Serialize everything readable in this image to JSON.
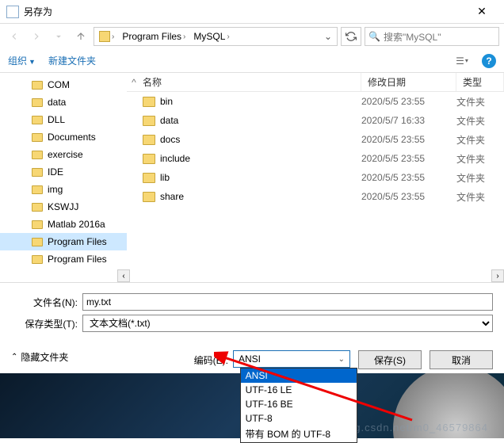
{
  "title": "另存为",
  "path": {
    "segments": [
      "Program Files",
      "MySQL"
    ]
  },
  "search": {
    "placeholder": "搜索\"MySQL\""
  },
  "toolbar": {
    "organize": "组织",
    "new_folder": "新建文件夹"
  },
  "sidebar": {
    "items": [
      {
        "label": "COM"
      },
      {
        "label": "data"
      },
      {
        "label": "DLL"
      },
      {
        "label": "Documents"
      },
      {
        "label": "exercise"
      },
      {
        "label": "IDE"
      },
      {
        "label": "img"
      },
      {
        "label": "KSWJJ"
      },
      {
        "label": "Matlab 2016a"
      },
      {
        "label": "Program Files",
        "selected": true
      },
      {
        "label": "Program Files"
      }
    ]
  },
  "columns": {
    "name": "名称",
    "date": "修改日期",
    "type": "类型"
  },
  "files": [
    {
      "name": "bin",
      "date": "2020/5/5 23:55",
      "type": "文件夹"
    },
    {
      "name": "data",
      "date": "2020/5/7 16:33",
      "type": "文件夹"
    },
    {
      "name": "docs",
      "date": "2020/5/5 23:55",
      "type": "文件夹"
    },
    {
      "name": "include",
      "date": "2020/5/5 23:55",
      "type": "文件夹"
    },
    {
      "name": "lib",
      "date": "2020/5/5 23:55",
      "type": "文件夹"
    },
    {
      "name": "share",
      "date": "2020/5/5 23:55",
      "type": "文件夹"
    }
  ],
  "form": {
    "filename_label": "文件名(N):",
    "filename_value": "my.txt",
    "filetype_label": "保存类型(T):",
    "filetype_value": "文本文档(*.txt)"
  },
  "bottom": {
    "hide_folders": "隐藏文件夹",
    "encoding_label": "编码(E):",
    "encoding_value": "ANSI",
    "encoding_options": [
      {
        "label": "ANSI",
        "selected": true
      },
      {
        "label": "UTF-16 LE"
      },
      {
        "label": "UTF-16 BE"
      },
      {
        "label": "UTF-8"
      },
      {
        "label": "带有 BOM 的 UTF-8"
      }
    ],
    "save": "保存(S)",
    "cancel": "取消"
  },
  "watermark": "blog.csdn.net/m0_46579864"
}
